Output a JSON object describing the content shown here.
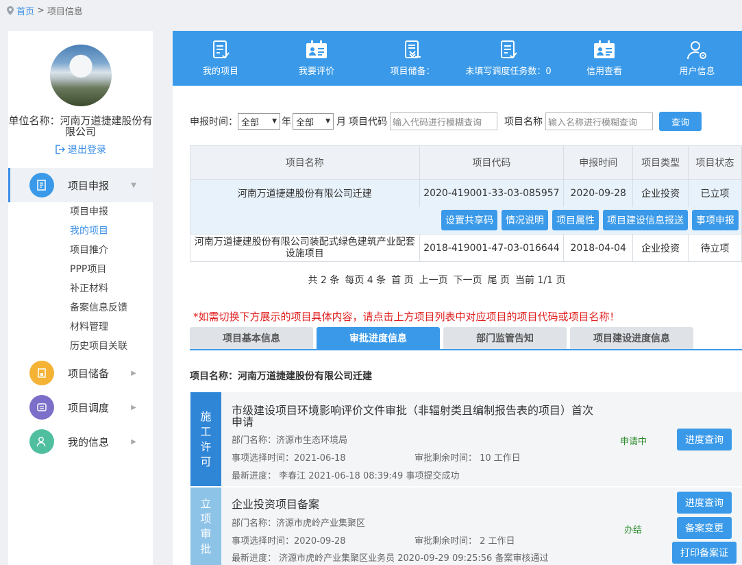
{
  "breadcrumb": {
    "home": "首页",
    "sep": ">",
    "current": "项目信息"
  },
  "sidebar": {
    "unit_name": "单位名称：河南万道捷建股份有限公司",
    "logout": "退出登录",
    "menu": [
      {
        "label": "项目申报",
        "color": "#3a9ae9"
      },
      {
        "label": "项目储备",
        "color": "#f5b335"
      },
      {
        "label": "项目调度",
        "color": "#7b6fc9"
      },
      {
        "label": "我的信息",
        "color": "#4fbf9f"
      }
    ],
    "submenu": [
      "项目申报",
      "我的项目",
      "项目推介",
      "PPP项目",
      "补正材料",
      "备案信息反馈",
      "材料管理",
      "历史项目关联"
    ]
  },
  "topbar": {
    "items": [
      {
        "label": "我的项目",
        "icon": "document-check-icon"
      },
      {
        "label": "我要评价",
        "icon": "id-card-icon"
      },
      {
        "label": "项目储备：",
        "icon": "document-stack-icon"
      },
      {
        "label": "未填写调度任务数：0",
        "icon": "document-check-icon"
      },
      {
        "label": "信用查看",
        "icon": "id-card-icon"
      },
      {
        "label": "用户信息",
        "icon": "user-gear-icon"
      }
    ]
  },
  "search": {
    "time_label": "申报时间：",
    "year_value": "全部",
    "year_suffix": "年",
    "month_value": "全部",
    "month_suffix": "月",
    "code_label": "项目代码",
    "code_placeholder": "输入代码进行模糊查询",
    "name_label": "项目名称",
    "name_placeholder": "输入名称进行模糊查询",
    "button": "查询"
  },
  "table": {
    "headers": [
      "项目名称",
      "项目代码",
      "申报时间",
      "项目类型",
      "项目状态"
    ],
    "rows": [
      {
        "name": "河南万道捷建股份有限公司迁建",
        "code": "2020-419001-33-03-085957",
        "date": "2020-09-28",
        "type": "企业投资",
        "status": "已立项"
      },
      {
        "name": "河南万道捷建股份有限公司装配式绿色建筑产业配套设施项目",
        "code": "2018-419001-47-03-016644",
        "date": "2018-04-04",
        "type": "企业投资",
        "status": "待立项"
      }
    ],
    "actions": [
      "设置共享码",
      "情况说明",
      "项目属性",
      "项目建设信息报送",
      "事项申报"
    ]
  },
  "pager": {
    "total": "共 2 条",
    "per_page": "每页 4 条",
    "first": "首 页",
    "prev": "上一页",
    "next": "下一页",
    "last": "尾 页",
    "current": "当前 1/1 页"
  },
  "notice": "*如需切换下方展示的项目具体内容，请点击上方项目列表中对应项目的项目代码或项目名称！",
  "tabs": [
    "项目基本信息",
    "审批进度信息",
    "部门监管告知",
    "项目建设进度信息"
  ],
  "project_name": "项目名称：河南万道捷建股份有限公司迁建",
  "cards": [
    {
      "side": "施工许可",
      "side_color": "#2f86d6",
      "title": "市级建设项目环境影响评价文件审批（非辐射类且编制报告表的项目）首次申请",
      "dept": "部门名称：济源市生态环境局",
      "select_time": "事项选择时间：2021-06-18",
      "remain": "审批剩余时间： 10 工作日",
      "progress": "最新进度： 李春江 2021-06-18 08:39:49  事项提交成功",
      "status": "申请中",
      "buttons": [
        "进度查询"
      ]
    },
    {
      "side": "立项审批",
      "side_color": "#8ec3e8",
      "title": "企业投资项目备案",
      "dept": "部门名称：济源市虎岭产业集聚区",
      "select_time": "事项选择时间：2020-09-28",
      "remain": "审批剩余时间： 2 工作日",
      "progress": "最新进度： 济源市虎岭产业集聚区业务员 2020-09-29 09:25:56 备案审核通过",
      "status": "办结",
      "buttons": [
        "进度查询",
        "备案变更",
        "打印备案证"
      ]
    }
  ]
}
